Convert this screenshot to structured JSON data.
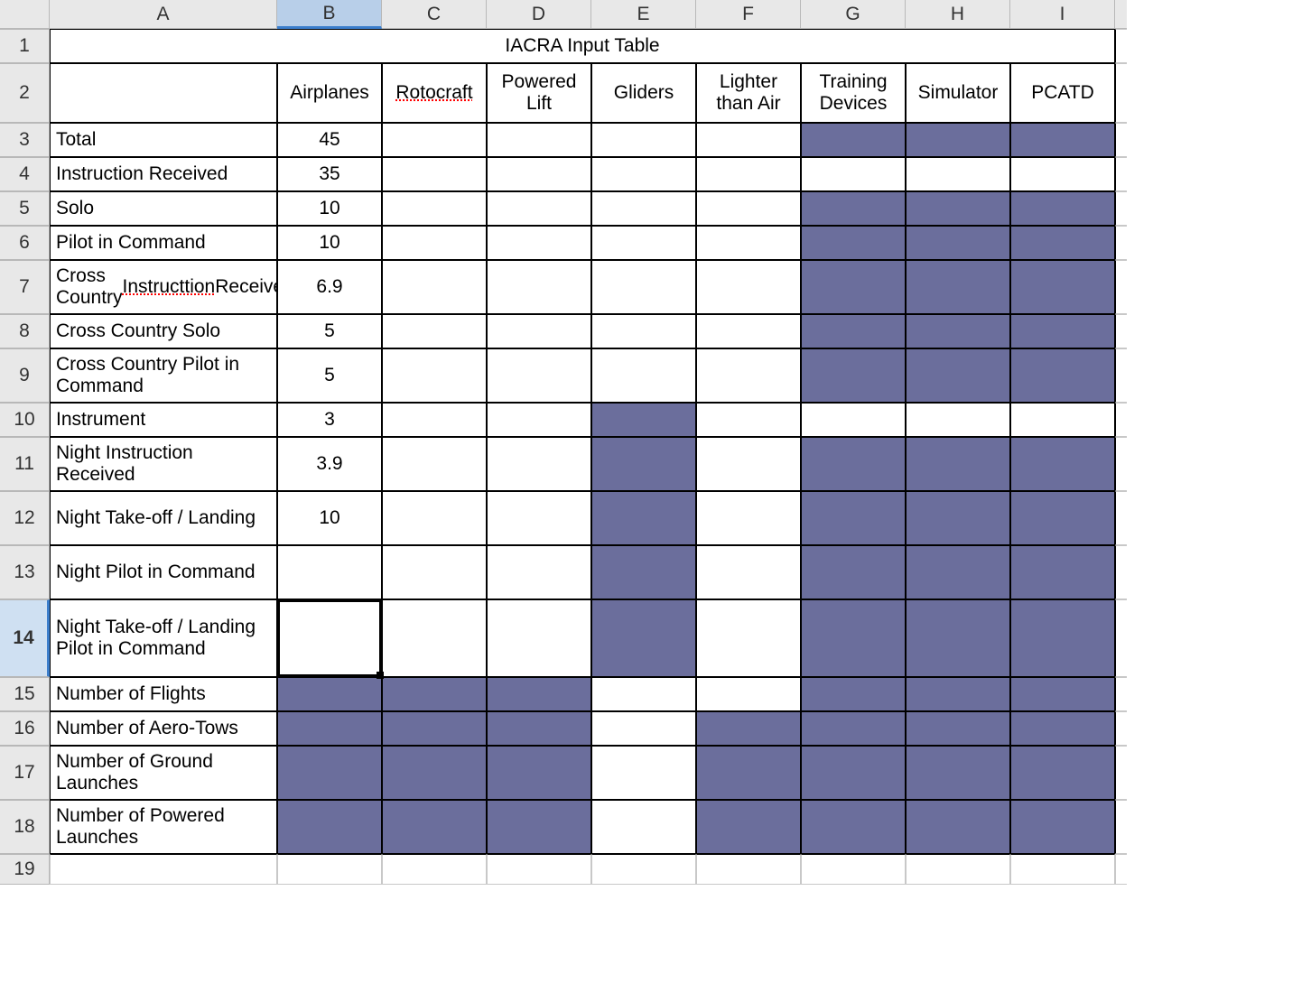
{
  "columns": [
    "A",
    "B",
    "C",
    "D",
    "E",
    "F",
    "G",
    "H",
    "I"
  ],
  "rowNumbers": [
    "1",
    "2",
    "3",
    "4",
    "5",
    "6",
    "7",
    "8",
    "9",
    "10",
    "11",
    "12",
    "13",
    "14",
    "15",
    "16",
    "17",
    "18",
    "19"
  ],
  "title": "IACRA Input Table",
  "headers": {
    "B": "Airplanes",
    "C": "Rotocraft",
    "D": "Powered Lift",
    "E": "Gliders",
    "F": "Lighter than Air",
    "G": "Training Devices",
    "H": "Simulator",
    "I": "PCATD"
  },
  "rows": {
    "r3": {
      "label": "Total",
      "B": "45"
    },
    "r4": {
      "label": "Instruction Received",
      "B": "35"
    },
    "r5": {
      "label": "Solo",
      "B": "10"
    },
    "r6": {
      "label": "Pilot in Command",
      "B": "10"
    },
    "r7": {
      "label": "Cross Country Instructtion Received",
      "B": "6.9"
    },
    "r8": {
      "label": "Cross Country Solo",
      "B": "5"
    },
    "r9": {
      "label": "Cross Country Pilot in Command",
      "B": "5"
    },
    "r10": {
      "label": "Instrument",
      "B": "3"
    },
    "r11": {
      "label": "Night Instruction Received",
      "B": "3.9"
    },
    "r12": {
      "label": "Night Take-off / Landing",
      "B": "10"
    },
    "r13": {
      "label": "Night Pilot in Command"
    },
    "r14": {
      "label": "Night Take-off / Landing Pilot in Command"
    },
    "r15": {
      "label": "Number of Flights"
    },
    "r16": {
      "label": "Number of Aero-Tows"
    },
    "r17": {
      "label": "Number of Ground Launches"
    },
    "r18": {
      "label": "Number of Powered Launches"
    }
  },
  "selectedCell": "B14",
  "selectedColumn": "B",
  "selectedRow": "14",
  "chart_data": {
    "type": "table",
    "title": "IACRA Input Table",
    "columns": [
      "Airplanes",
      "Rotocraft",
      "Powered Lift",
      "Gliders",
      "Lighter than Air",
      "Training Devices",
      "Simulator",
      "PCATD"
    ],
    "rows": [
      {
        "metric": "Total",
        "Airplanes": 45
      },
      {
        "metric": "Instruction Received",
        "Airplanes": 35
      },
      {
        "metric": "Solo",
        "Airplanes": 10
      },
      {
        "metric": "Pilot in Command",
        "Airplanes": 10
      },
      {
        "metric": "Cross Country Instructtion Received",
        "Airplanes": 6.9
      },
      {
        "metric": "Cross Country Solo",
        "Airplanes": 5
      },
      {
        "metric": "Cross Country Pilot in Command",
        "Airplanes": 5
      },
      {
        "metric": "Instrument",
        "Airplanes": 3
      },
      {
        "metric": "Night Instruction Received",
        "Airplanes": 3.9
      },
      {
        "metric": "Night Take-off / Landing",
        "Airplanes": 10
      },
      {
        "metric": "Night Pilot in Command"
      },
      {
        "metric": "Night Take-off / Landing Pilot in Command"
      },
      {
        "metric": "Number of Flights"
      },
      {
        "metric": "Number of Aero-Tows"
      },
      {
        "metric": "Number of Ground Launches"
      },
      {
        "metric": "Number of Powered Launches"
      }
    ]
  }
}
